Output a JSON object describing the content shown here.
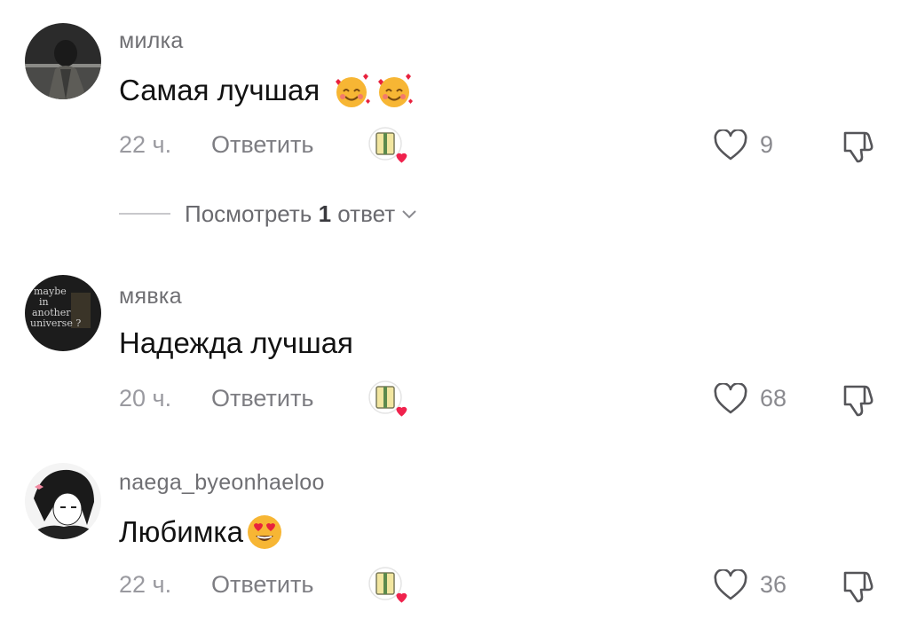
{
  "comments": [
    {
      "username": "милка",
      "text": "Самая лучшая",
      "emojis": [
        "smiling-face-with-hearts",
        "smiling-face-with-hearts"
      ],
      "time": "22 ч.",
      "reply_label": "Ответить",
      "likes": "9"
    },
    {
      "username": "мявка",
      "text": "Надежда лучшая",
      "emojis": [],
      "time": "20 ч.",
      "reply_label": "Ответить",
      "likes": "68",
      "avatar_text": [
        "maybe",
        "in",
        "another",
        "universe ?"
      ]
    },
    {
      "username": "naega_byeonhaeloo",
      "text": "Любимка",
      "emojis": [
        "heart-eyes"
      ],
      "time": "22 ч.",
      "reply_label": "Ответить",
      "likes": "36"
    }
  ],
  "view_replies": {
    "prefix": "Посмотреть",
    "count": "1",
    "suffix": "ответ"
  },
  "icons": {
    "like": "heart-outline-icon",
    "dislike": "thumbs-down-outline-icon",
    "creator_liked": "creator-liked-badge-icon",
    "expand": "chevron-down-icon"
  },
  "colors": {
    "text": "#121212",
    "muted": "#9a9aa0",
    "heart": "#f0224d"
  }
}
